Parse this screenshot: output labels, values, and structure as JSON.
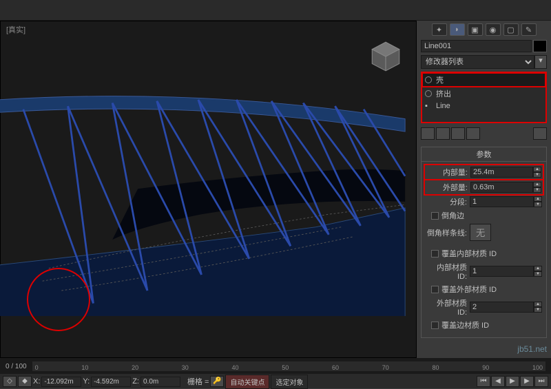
{
  "viewport": {
    "label": "[真实]"
  },
  "panel": {
    "object_name": "Line001",
    "modifier_dropdown": "修改器列表",
    "modifiers": [
      {
        "label": "壳",
        "eye": true,
        "hl": true
      },
      {
        "label": "挤出",
        "eye": true,
        "hl": false
      },
      {
        "label": "Line",
        "eye": false,
        "hl": false
      }
    ],
    "params_title": "参数",
    "inner_label": "内部量:",
    "inner_value": "25.4m",
    "outer_label": "外部量:",
    "outer_value": "0.63m",
    "seg_label": "分段:",
    "seg_value": "1",
    "bevel_edges": "倒角边",
    "bevel_spline_label": "倒角样条线:",
    "bevel_spline_btn": "无",
    "override_inner_mat": "覆盖内部材质 ID",
    "inner_mat_label": "内部材质 ID:",
    "inner_mat_value": "1",
    "override_outer_mat": "覆盖外部材质 ID",
    "outer_mat_label": "外部材质 ID:",
    "outer_mat_value": "2",
    "override_edge_mat": "覆盖边材质 ID"
  },
  "status": {
    "frame": "0 / 100",
    "ticks": [
      "0",
      "10",
      "20",
      "30",
      "40",
      "50",
      "60",
      "70",
      "80",
      "90",
      "100"
    ],
    "x_label": "X:",
    "x_value": "-12.092m",
    "y_label": "Y:",
    "y_value": "-4.592m",
    "z_label": "Z:",
    "z_value": "0.0m",
    "grid": "栅格 =",
    "auto_key": "自动关键点",
    "sel_obj": "选定对象"
  },
  "watermark": "jb51.net"
}
